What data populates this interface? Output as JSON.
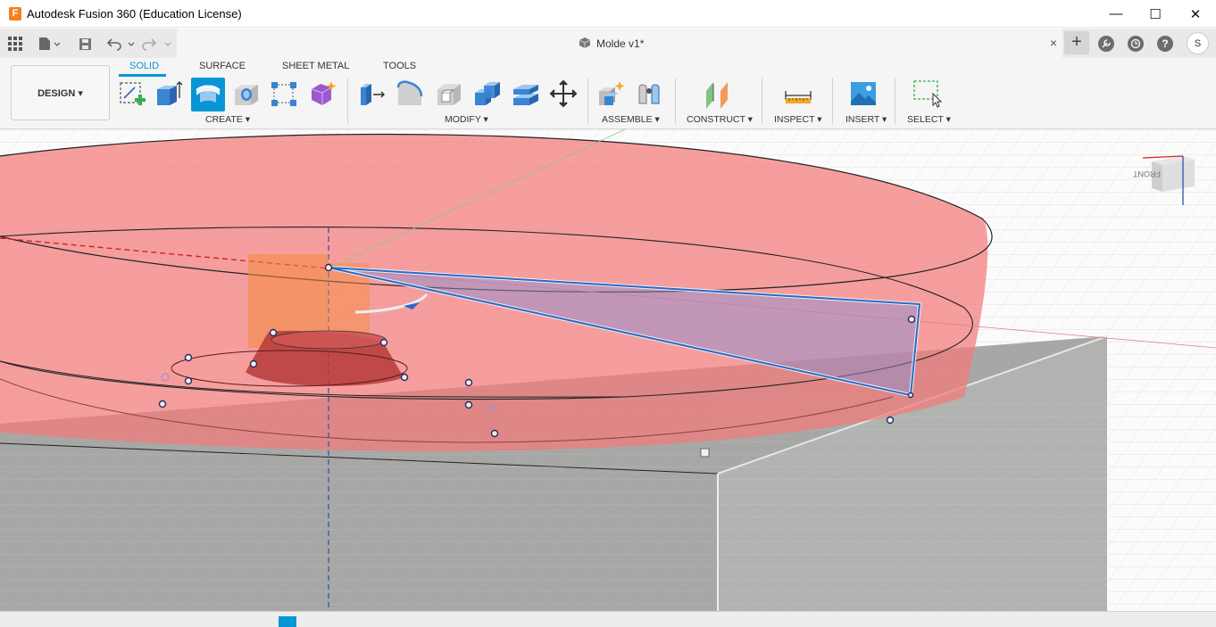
{
  "window": {
    "title": "Autodesk Fusion 360 (Education License)",
    "app_icon_letter": "F",
    "minimize": "—",
    "maximize": "☐",
    "close": "✕"
  },
  "tabbar": {
    "document_title": "Molde v1*",
    "close_tab": "×",
    "new_tab": "+",
    "user_initial": "S"
  },
  "toolbar": {
    "workspace": "DESIGN ▾",
    "tabs": [
      {
        "label": "SOLID",
        "active": true
      },
      {
        "label": "SURFACE",
        "active": false
      },
      {
        "label": "SHEET METAL",
        "active": false
      },
      {
        "label": "TOOLS",
        "active": false
      }
    ],
    "groups": {
      "create": "CREATE ▾",
      "modify": "MODIFY ▾",
      "assemble": "ASSEMBLE ▾",
      "construct": "CONSTRUCT ▾",
      "inspect": "INSPECT ▾",
      "insert": "INSERT ▾",
      "select": "SELECT ▾"
    }
  },
  "viewcube": {
    "face_label": "FRONT"
  },
  "colors": {
    "accent": "#0696d7",
    "disc_fill": "#f47a7a",
    "block_fill": "#a9aba8",
    "sketch_line": "#2b67c9"
  }
}
